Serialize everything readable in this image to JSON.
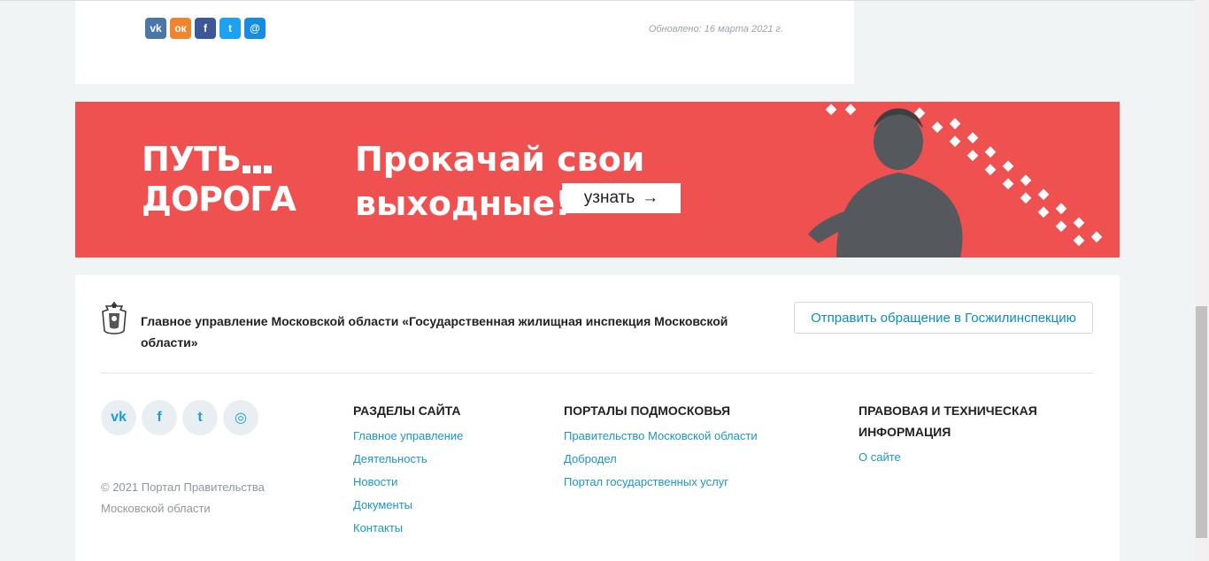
{
  "article": {
    "updated": "Обновлено: 16 марта 2021 г.",
    "share": [
      {
        "icon": "vk-icon",
        "glyph": "vk",
        "color": "#4a76a8"
      },
      {
        "icon": "odnoklassniki-icon",
        "glyph": "ок",
        "color": "#f0852d"
      },
      {
        "icon": "facebook-icon",
        "glyph": "f",
        "color": "#3b5998"
      },
      {
        "icon": "twitter-icon",
        "glyph": "t",
        "color": "#1da1f2"
      },
      {
        "icon": "moimir-icon",
        "glyph": "@",
        "color": "#168de2"
      }
    ]
  },
  "banner": {
    "brand_line1": "ПУТЬ",
    "brand_line2": "ДОРОГА",
    "slogan_line1": "Прокачай свои",
    "slogan_line2": "выходные!",
    "cta": "узнать",
    "color": "#ef5050"
  },
  "footer": {
    "org_name": "Главное управление Московской области «Государственная жилищная инспекция Московской области»",
    "appeal_button": "Отправить обращение в Госжилинспекцию",
    "copyright": "© 2021 Портал Правительства Московской области",
    "social": [
      {
        "icon": "vk-icon",
        "glyph": "vk"
      },
      {
        "icon": "facebook-icon",
        "glyph": "f"
      },
      {
        "icon": "twitter-icon",
        "glyph": "t"
      },
      {
        "icon": "instagram-icon",
        "glyph": "◎"
      }
    ],
    "columns": [
      {
        "title": "РАЗДЕЛЫ САЙТА",
        "links": [
          "Главное управление",
          "Деятельность",
          "Новости",
          "Документы",
          "Контакты"
        ]
      },
      {
        "title": "ПОРТАЛЫ ПОДМОСКОВЬЯ",
        "links": [
          "Правительство Московской области",
          "Добродел",
          "Портал государственных услуг"
        ]
      },
      {
        "title": "ПРАВОВАЯ И ТЕХНИЧЕСКАЯ ИНФОРМАЦИЯ",
        "links": [
          "О сайте"
        ]
      }
    ],
    "link_color": "#1a95c8"
  }
}
